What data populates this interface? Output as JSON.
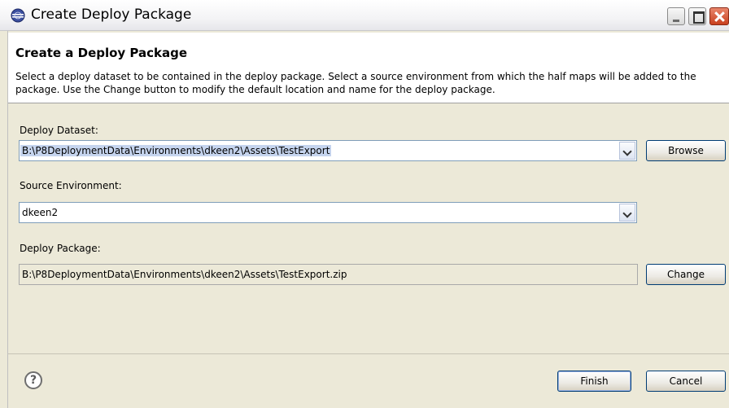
{
  "window": {
    "title": "Create Deploy Package",
    "title_icon": "eclipse-icon"
  },
  "header": {
    "title": "Create a Deploy Package",
    "description": "Select a deploy dataset to be contained in the deploy package.  Select a source environment from which the half maps will be added to the package.  Use the Change button to modify the default location and name for the deploy package."
  },
  "form": {
    "dataset_label": "Deploy Dataset:",
    "dataset_value": "B:\\P8DeploymentData\\Environments\\dkeen2\\Assets\\TestExport",
    "browse_label": "Browse",
    "source_label": "Source Environment:",
    "source_value": "dkeen2",
    "package_label": "Deploy Package:",
    "package_value": "B:\\P8DeploymentData\\Environments\\dkeen2\\Assets\\TestExport.zip",
    "change_label": "Change"
  },
  "footer": {
    "help_glyph": "?",
    "finish_label": "Finish",
    "cancel_label": "Cancel"
  }
}
